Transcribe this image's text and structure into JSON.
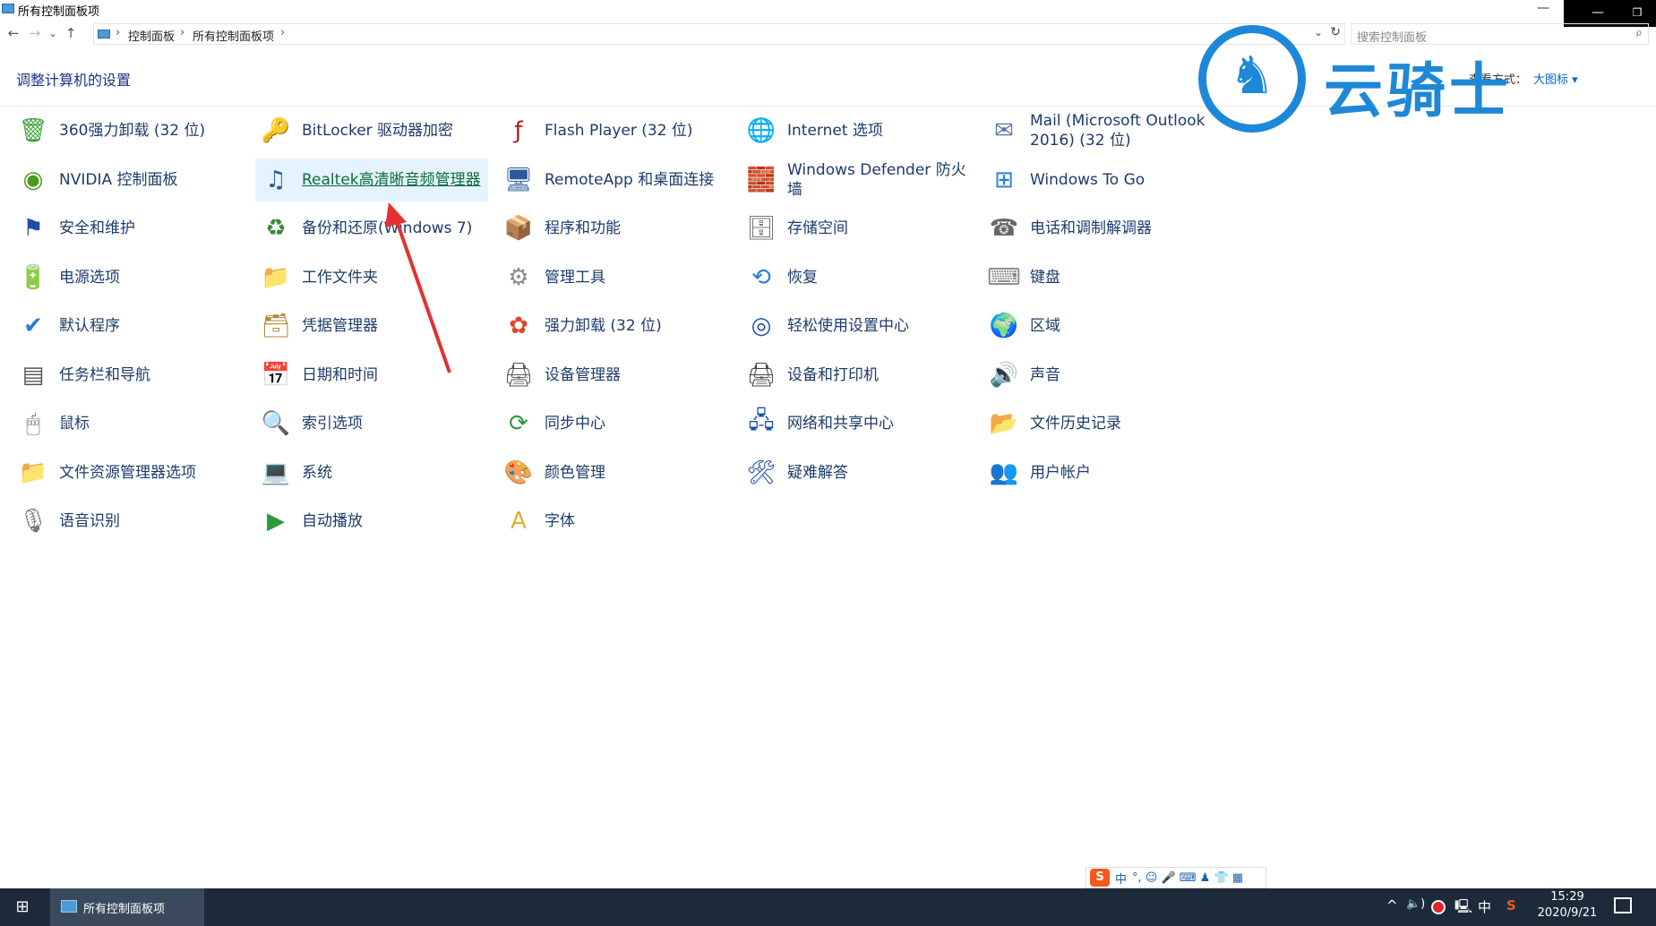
{
  "window": {
    "title": "所有控制面板项",
    "min_label": "—",
    "max_label": "☐",
    "close_label": "❐"
  },
  "nav": {
    "back": "←",
    "forward": "→",
    "recent": "⌄",
    "up": "↑",
    "breadcrumbs": [
      "控制面板",
      "所有控制面板项"
    ],
    "sep": "›",
    "drop": "⌄",
    "refresh": "↻",
    "search_placeholder": "搜索控制面板"
  },
  "header": {
    "title": "调整计算机的设置",
    "view_by_label": "查看方式：",
    "view_by_value": "大图标 ▾"
  },
  "watermark": {
    "text": "云骑士"
  },
  "items": [
    {
      "label": "360强力卸载 (32 位)",
      "icon": "uninstaller-icon",
      "glyph": "🗑",
      "color": "#3aa33a"
    },
    {
      "label": "BitLocker 驱动器加密",
      "icon": "bitlocker-icon",
      "glyph": "🔑",
      "color": "#b08a3a"
    },
    {
      "label": "Flash Player (32 位)",
      "icon": "flash-player-icon",
      "glyph": "ƒ",
      "color": "#b01c1c"
    },
    {
      "label": "Internet 选项",
      "icon": "internet-options-icon",
      "glyph": "🌐",
      "color": "#2a7ed6"
    },
    {
      "label": "Mail (Microsoft Outlook 2016) (32 位)",
      "icon": "mail-icon",
      "glyph": "✉",
      "color": "#5577aa"
    },
    {
      "label": "NVIDIA 控制面板",
      "icon": "nvidia-icon",
      "glyph": "◉",
      "color": "#4a9a1a"
    },
    {
      "label": "Realtek高清晰音频管理器",
      "icon": "realtek-audio-icon",
      "glyph": "♫",
      "color": "#2a5a9a",
      "highlight": true
    },
    {
      "label": "RemoteApp 和桌面连接",
      "icon": "remoteapp-icon",
      "glyph": "🖥",
      "color": "#2a5a9a"
    },
    {
      "label": "Windows Defender 防火墙",
      "icon": "firewall-icon",
      "glyph": "🧱",
      "color": "#a0522d"
    },
    {
      "label": "Windows To Go",
      "icon": "windows-to-go-icon",
      "glyph": "⊞",
      "color": "#2a7ed6"
    },
    {
      "label": "安全和维护",
      "icon": "security-flag-icon",
      "glyph": "⚑",
      "color": "#1d4fa8"
    },
    {
      "label": "备份和还原(Windows 7)",
      "icon": "backup-icon",
      "glyph": "♻",
      "color": "#3a8a3a"
    },
    {
      "label": "程序和功能",
      "icon": "programs-icon",
      "glyph": "📦",
      "color": "#777"
    },
    {
      "label": "存储空间",
      "icon": "storage-icon",
      "glyph": "🗄",
      "color": "#777"
    },
    {
      "label": "电话和调制解调器",
      "icon": "phone-modem-icon",
      "glyph": "☎",
      "color": "#666"
    },
    {
      "label": "电源选项",
      "icon": "power-icon",
      "glyph": "🔋",
      "color": "#3a9a3a"
    },
    {
      "label": "工作文件夹",
      "icon": "work-folder-icon",
      "glyph": "📁",
      "color": "#e0b030"
    },
    {
      "label": "管理工具",
      "icon": "admin-tools-icon",
      "glyph": "⚙",
      "color": "#888"
    },
    {
      "label": "恢复",
      "icon": "recovery-icon",
      "glyph": "⟲",
      "color": "#2a7ed6"
    },
    {
      "label": "键盘",
      "icon": "keyboard-icon",
      "glyph": "⌨",
      "color": "#888"
    },
    {
      "label": "默认程序",
      "icon": "default-programs-icon",
      "glyph": "✔",
      "color": "#2a7ed6"
    },
    {
      "label": "凭据管理器",
      "icon": "credential-icon",
      "glyph": "🗃",
      "color": "#b08a3a"
    },
    {
      "label": "强力卸载 (32 位)",
      "icon": "clover-icon",
      "glyph": "✿",
      "color": "#e0442a"
    },
    {
      "label": "轻松使用设置中心",
      "icon": "ease-of-access-icon",
      "glyph": "◎",
      "color": "#1d4fa8"
    },
    {
      "label": "区域",
      "icon": "region-icon",
      "glyph": "🌍",
      "color": "#2a7ed6"
    },
    {
      "label": "任务栏和导航",
      "icon": "taskbar-icon",
      "glyph": "▤",
      "color": "#555"
    },
    {
      "label": "日期和时间",
      "icon": "date-time-icon",
      "glyph": "📅",
      "color": "#2a7ed6"
    },
    {
      "label": "设备管理器",
      "icon": "device-manager-icon",
      "glyph": "🖨",
      "color": "#555"
    },
    {
      "label": "设备和打印机",
      "icon": "printer-icon",
      "glyph": "🖨",
      "color": "#444"
    },
    {
      "label": "声音",
      "icon": "sound-icon",
      "glyph": "🔊",
      "color": "#777"
    },
    {
      "label": "鼠标",
      "icon": "mouse-icon",
      "glyph": "🖱",
      "color": "#666"
    },
    {
      "label": "索引选项",
      "icon": "indexing-icon",
      "glyph": "🔍",
      "color": "#666"
    },
    {
      "label": "同步中心",
      "icon": "sync-center-icon",
      "glyph": "⟳",
      "color": "#2a9a3a"
    },
    {
      "label": "网络和共享中心",
      "icon": "network-icon",
      "glyph": "🖧",
      "color": "#1d4fa8"
    },
    {
      "label": "文件历史记录",
      "icon": "file-history-icon",
      "glyph": "📂",
      "color": "#e0b030"
    },
    {
      "label": "文件资源管理器选项",
      "icon": "explorer-options-icon",
      "glyph": "📁",
      "color": "#e0b030"
    },
    {
      "label": "系统",
      "icon": "system-icon",
      "glyph": "💻",
      "color": "#2a7ed6"
    },
    {
      "label": "颜色管理",
      "icon": "color-management-icon",
      "glyph": "🎨",
      "color": "#2a7ed6"
    },
    {
      "label": "疑难解答",
      "icon": "troubleshoot-icon",
      "glyph": "🛠",
      "color": "#1d4fa8"
    },
    {
      "label": "用户帐户",
      "icon": "user-accounts-icon",
      "glyph": "👥",
      "color": "#3a8a3a"
    },
    {
      "label": "语音识别",
      "icon": "microphone-icon",
      "glyph": "🎙",
      "color": "#777"
    },
    {
      "label": "自动播放",
      "icon": "autoplay-icon",
      "glyph": "▶",
      "color": "#2a9a3a"
    },
    {
      "label": "字体",
      "icon": "fonts-icon",
      "glyph": "A",
      "color": "#e0b030"
    }
  ],
  "ime": {
    "logo": "S",
    "mode": "中",
    "icons": "°, ☺ 🎤 ⌨ ♟ 👕 ▦"
  },
  "taskbar": {
    "start_glyph": "⊞",
    "app_label": "所有控制面板项",
    "tray_chevron": "^",
    "volume": "🔈)",
    "network": "🖳",
    "input_lang": "中",
    "sogou": "S",
    "time": "15:29",
    "date": "2020/9/21"
  }
}
